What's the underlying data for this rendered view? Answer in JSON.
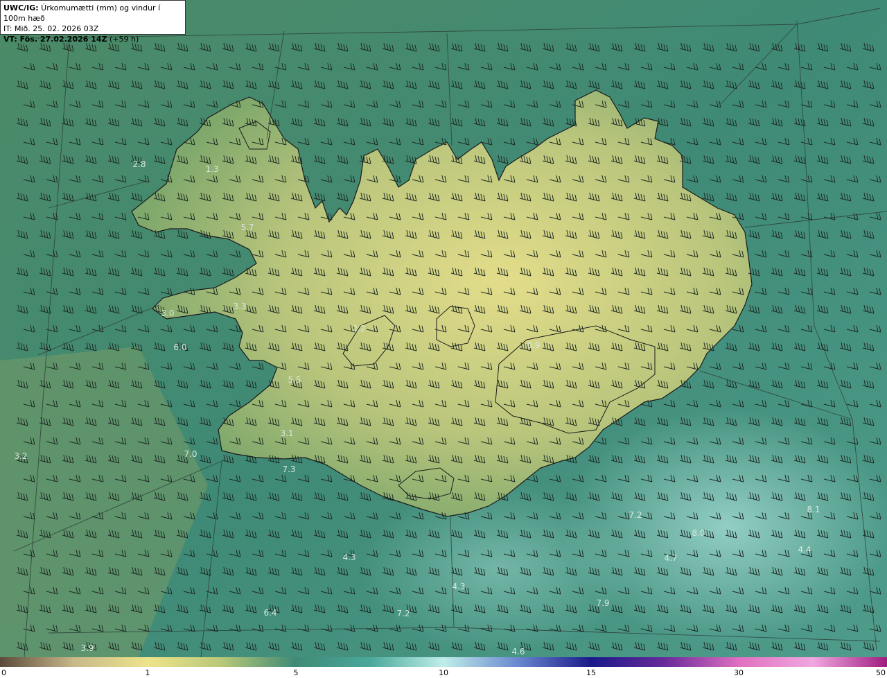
{
  "header": {
    "model_bold": "UWC/IG:",
    "title_rest": " Úrkomumætti (mm) og vindur í 100m hæð",
    "init_time": "IT: Mið. 25. 02. 2026 03Z",
    "valid_bold": "VT: Fös. 27.02.2026 14Z",
    "valid_rest": " (+59 h)"
  },
  "colors": {
    "ocean": "#3f8a76",
    "land_low": "#b8c27a",
    "land_high": "#e3dd8a",
    "coast": "#1a1a1a",
    "barb": "#1e2a24",
    "label": "#d8e8e0"
  },
  "map_labels": [
    {
      "id": "l01",
      "text": "2.8"
    },
    {
      "id": "l02",
      "text": "1.3"
    },
    {
      "id": "l03",
      "text": "5.7"
    },
    {
      "id": "l04",
      "text": "3.3"
    },
    {
      "id": "l05",
      "text": "3.0"
    },
    {
      "id": "l06",
      "text": "6.0"
    },
    {
      "id": "l07",
      "text": "5.5"
    },
    {
      "id": "l08",
      "text": "3.1"
    },
    {
      "id": "l09",
      "text": "7.0"
    },
    {
      "id": "l10",
      "text": "3.2"
    },
    {
      "id": "l11",
      "text": "7.3"
    },
    {
      "id": "l12",
      "text": "4.3"
    },
    {
      "id": "l13",
      "text": "4.3"
    },
    {
      "id": "l14",
      "text": "6.4"
    },
    {
      "id": "l15",
      "text": "7.2"
    },
    {
      "id": "l16",
      "text": "3.9"
    },
    {
      "id": "l17",
      "text": "4.6"
    },
    {
      "id": "l18",
      "text": "7.9"
    },
    {
      "id": "l19",
      "text": "4.7"
    },
    {
      "id": "l20",
      "text": "8.0"
    },
    {
      "id": "l21",
      "text": "7.2"
    },
    {
      "id": "l22",
      "text": "8.1"
    },
    {
      "id": "l23",
      "text": "4.4"
    },
    {
      "id": "l24",
      "text": "2.2"
    },
    {
      "id": "l25",
      "text": "0.9"
    }
  ],
  "colorbar": {
    "ticks": [
      "0",
      "1",
      "5",
      "10",
      "15",
      "30",
      "50"
    ],
    "stops": [
      "#5a4a3a",
      "#c9b88a",
      "#eee48a",
      "#b8c878",
      "#3f8a76",
      "#4aa89a",
      "#bfeee8",
      "#6a88d0",
      "#1a1a8a",
      "#6a2a9a",
      "#e070c0",
      "#f0a8e0",
      "#a01c80"
    ]
  }
}
